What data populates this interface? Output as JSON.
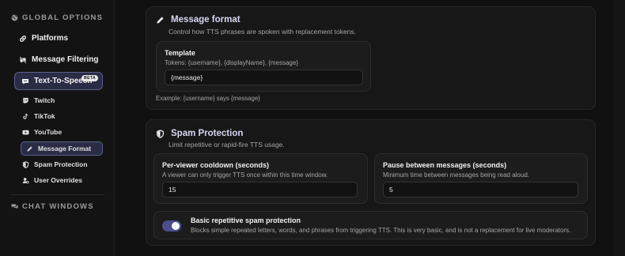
{
  "sidebar": {
    "global_header": "GLOBAL OPTIONS",
    "items": {
      "platforms": "Platforms",
      "message_filtering": "Message Filtering",
      "tts": "Text-To-Speech",
      "tts_badge": "BETA"
    },
    "subitems": {
      "twitch": "Twitch",
      "tiktok": "TikTok",
      "youtube": "YouTube",
      "message_format": "Message Format",
      "spam_protection": "Spam Protection",
      "user_overrides": "User Overrides"
    },
    "chat_header": "CHAT WINDOWS"
  },
  "message_format": {
    "title": "Message format",
    "subtitle": "Control how TTS phrases are spoken with replacement tokens.",
    "template_label": "Template",
    "tokens": "Tokens: {username}, {displayName}, {message}",
    "template_value": "{message}",
    "example": "Example: {username} says {message}"
  },
  "spam": {
    "title": "Spam Protection",
    "subtitle": "Limit repetitive or rapid-fire TTS usage.",
    "cooldown_label": "Per-viewer cooldown (seconds)",
    "cooldown_desc": "A viewer can only trigger TTS once within this time window.",
    "cooldown_value": "15",
    "pause_label": "Pause between messages (seconds)",
    "pause_desc": "Minimum time between messages being read aloud.",
    "pause_value": "5",
    "basic_label": "Basic repetitive spam protection",
    "basic_desc": "Blocks simple repeated letters, words, and phrases from triggering TTS. This is very basic, and is not a replacement for live moderators.",
    "basic_enabled": true
  },
  "colors": {
    "accent": "#5b5f8c",
    "accent_bg": "#2a2c45",
    "toggle_on": "#4a4f8c"
  }
}
